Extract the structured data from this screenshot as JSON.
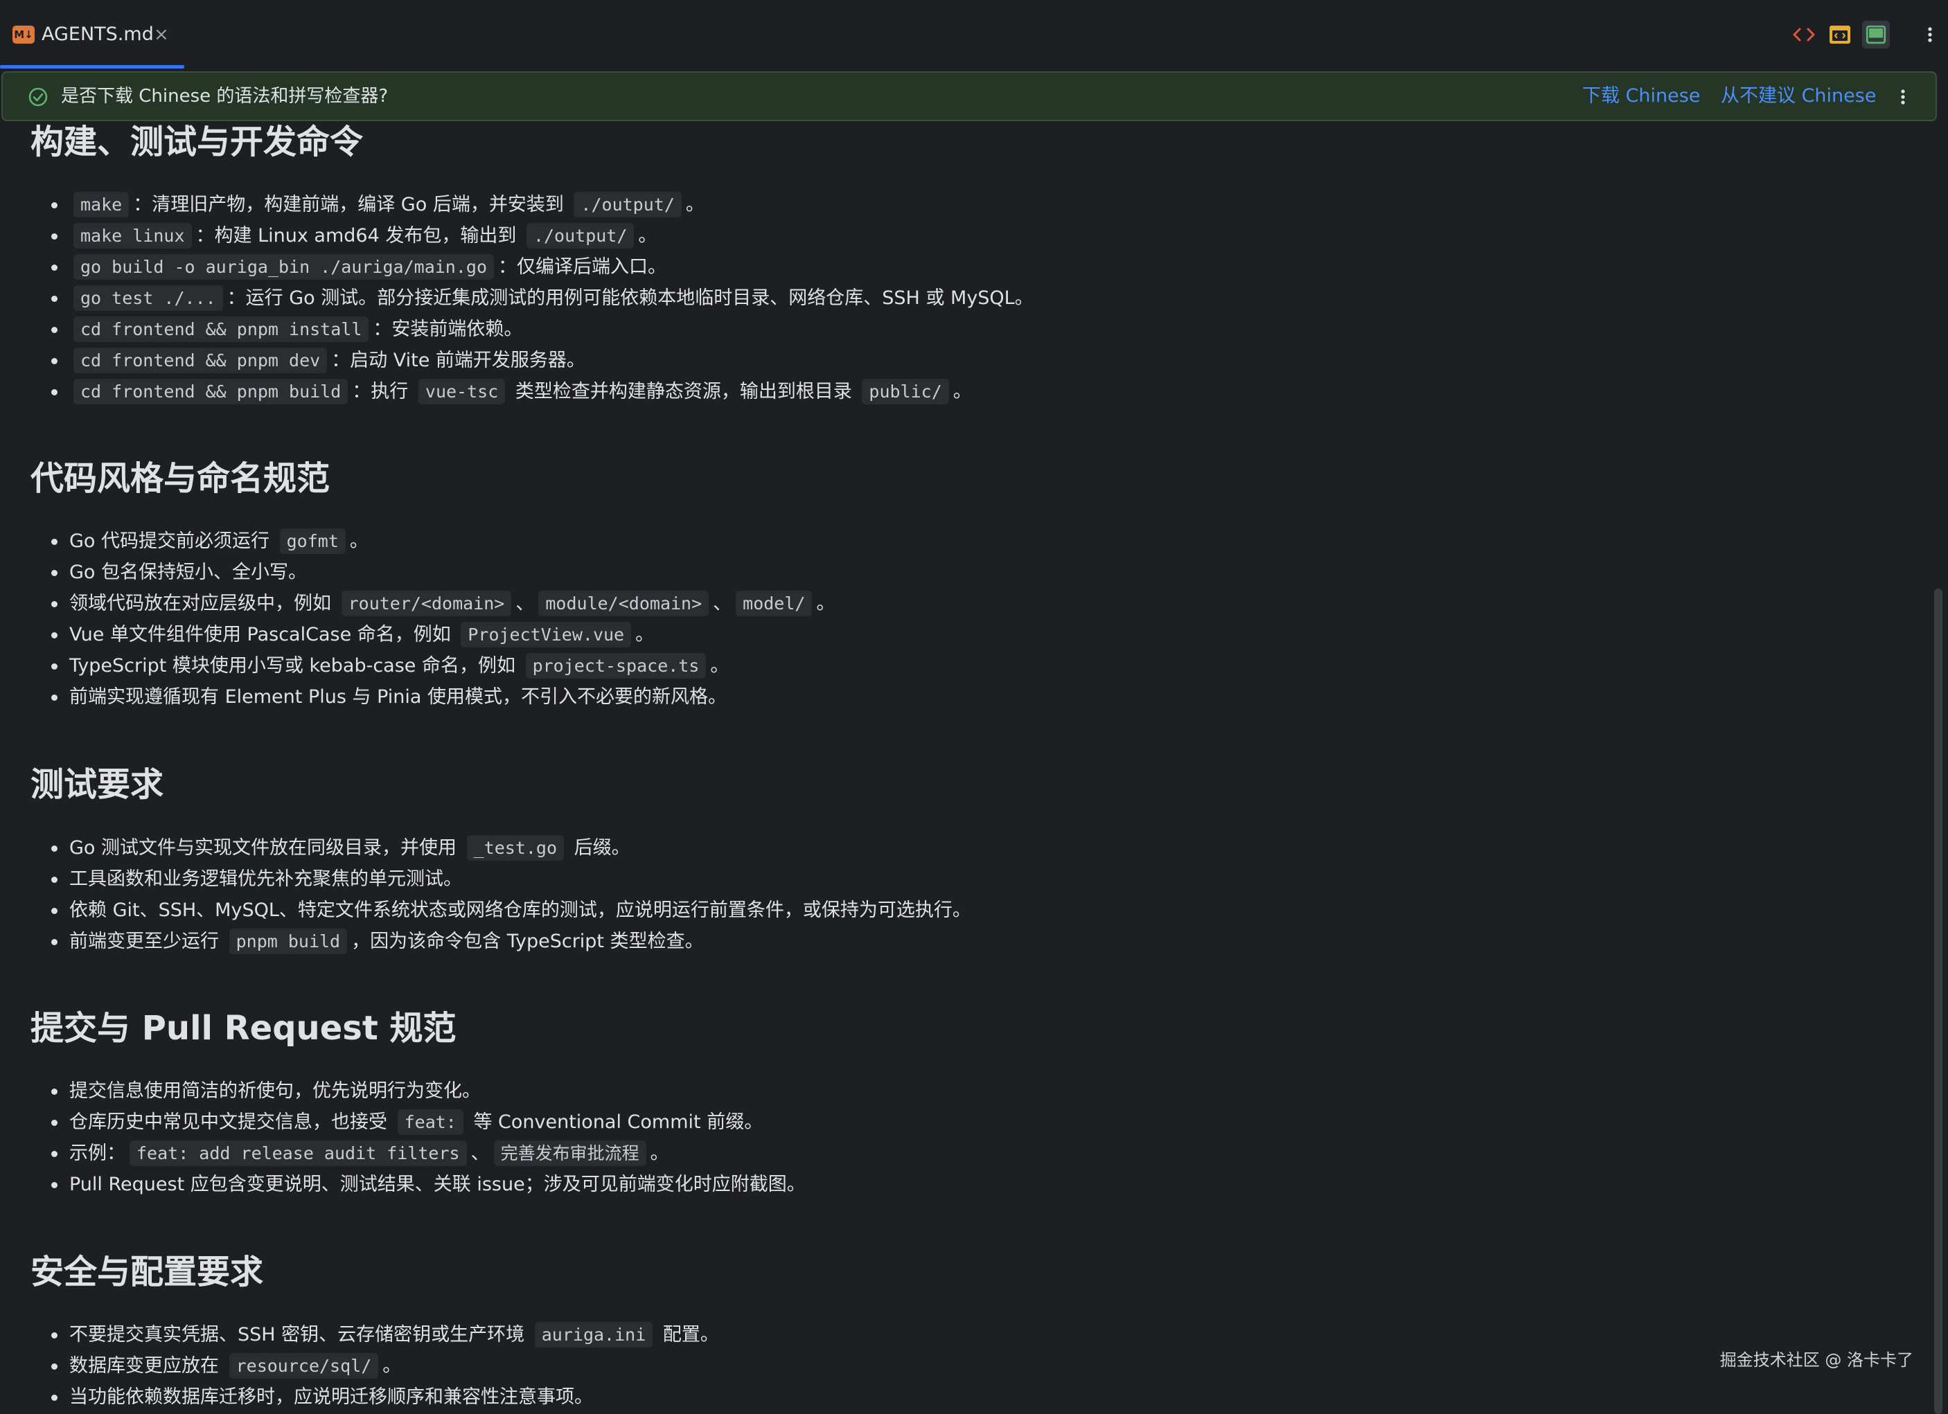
{
  "tab": {
    "icon_label": "M↓",
    "title": "AGENTS.md",
    "close": "×"
  },
  "toolbar": {
    "icons": [
      "code-view-icon",
      "split-preview-icon",
      "preview-icon",
      "more-vertical-icon"
    ],
    "colors": {
      "code": "#e0563f",
      "split": "#e8b02a",
      "preview": "#5fb36e"
    }
  },
  "banner": {
    "message": "是否下载 Chinese 的语法和拼写检查器?",
    "download_label": "下载 Chinese",
    "never_label": "从不建议 Chinese"
  },
  "sections": [
    {
      "title": "构建、测试与开发命令",
      "items": [
        [
          {
            "c": "make"
          },
          {
            "t": "：清理旧产物，构建前端，编译 Go 后端，并安装到 "
          },
          {
            "c": "./output/"
          },
          {
            "t": "。"
          }
        ],
        [
          {
            "c": "make linux"
          },
          {
            "t": "：构建 Linux amd64 发布包，输出到 "
          },
          {
            "c": "./output/"
          },
          {
            "t": "。"
          }
        ],
        [
          {
            "c": "go build -o auriga_bin ./auriga/main.go"
          },
          {
            "t": "：仅编译后端入口。"
          }
        ],
        [
          {
            "c": "go test ./..."
          },
          {
            "t": "：运行 Go 测试。部分接近集成测试的用例可能依赖本地临时目录、网络仓库、SSH 或 MySQL。"
          }
        ],
        [
          {
            "c": "cd frontend && pnpm install"
          },
          {
            "t": "：安装前端依赖。"
          }
        ],
        [
          {
            "c": "cd frontend && pnpm dev"
          },
          {
            "t": "：启动 Vite 前端开发服务器。"
          }
        ],
        [
          {
            "c": "cd frontend && pnpm build"
          },
          {
            "t": "：执行 "
          },
          {
            "c": "vue-tsc"
          },
          {
            "t": " 类型检查并构建静态资源，输出到根目录 "
          },
          {
            "c": "public/"
          },
          {
            "t": "。"
          }
        ]
      ]
    },
    {
      "title": "代码风格与命名规范",
      "items": [
        [
          {
            "t": "Go 代码提交前必须运行 "
          },
          {
            "c": "gofmt"
          },
          {
            "t": "。"
          }
        ],
        [
          {
            "t": "Go 包名保持短小、全小写。"
          }
        ],
        [
          {
            "t": "领域代码放在对应层级中，例如 "
          },
          {
            "c": "router/<domain>"
          },
          {
            "t": "、"
          },
          {
            "c": "module/<domain>"
          },
          {
            "t": "、"
          },
          {
            "c": "model/"
          },
          {
            "t": "。"
          }
        ],
        [
          {
            "t": "Vue 单文件组件使用 PascalCase 命名，例如 "
          },
          {
            "c": "ProjectView.vue"
          },
          {
            "t": "。"
          }
        ],
        [
          {
            "t": "TypeScript 模块使用小写或 kebab-case 命名，例如 "
          },
          {
            "c": "project-space.ts"
          },
          {
            "t": "。"
          }
        ],
        [
          {
            "t": "前端实现遵循现有 Element Plus 与 Pinia 使用模式，不引入不必要的新风格。"
          }
        ]
      ]
    },
    {
      "title": "测试要求",
      "items": [
        [
          {
            "t": "Go 测试文件与实现文件放在同级目录，并使用 "
          },
          {
            "c": "_test.go"
          },
          {
            "t": " 后缀。"
          }
        ],
        [
          {
            "t": "工具函数和业务逻辑优先补充聚焦的单元测试。"
          }
        ],
        [
          {
            "t": "依赖 Git、SSH、MySQL、特定文件系统状态或网络仓库的测试，应说明运行前置条件，或保持为可选执行。"
          }
        ],
        [
          {
            "t": "前端变更至少运行 "
          },
          {
            "c": "pnpm build"
          },
          {
            "t": "，因为该命令包含 TypeScript 类型检查。"
          }
        ]
      ]
    },
    {
      "title": "提交与 Pull Request 规范",
      "items": [
        [
          {
            "t": "提交信息使用简洁的祈使句，优先说明行为变化。"
          }
        ],
        [
          {
            "t": "仓库历史中常见中文提交信息，也接受 "
          },
          {
            "c": "feat:"
          },
          {
            "t": " 等 Conventional Commit 前缀。"
          }
        ],
        [
          {
            "t": "示例："
          },
          {
            "c": "feat: add release audit filters"
          },
          {
            "t": "、"
          },
          {
            "c": "完善发布审批流程"
          },
          {
            "t": "。"
          }
        ],
        [
          {
            "t": "Pull Request 应包含变更说明、测试结果、关联 issue；涉及可见前端变化时应附截图。"
          }
        ]
      ]
    },
    {
      "title": "安全与配置要求",
      "items": [
        [
          {
            "t": "不要提交真实凭据、SSH 密钥、云存储密钥或生产环境 "
          },
          {
            "c": "auriga.ini"
          },
          {
            "t": " 配置。"
          }
        ],
        [
          {
            "t": "数据库变更应放在 "
          },
          {
            "c": "resource/sql/"
          },
          {
            "t": "。"
          }
        ],
        [
          {
            "t": "当功能依赖数据库迁移时，应说明迁移顺序和兼容性注意事项。"
          }
        ]
      ]
    }
  ],
  "watermark": "掘金技术社区 @ 洛卡卡了"
}
